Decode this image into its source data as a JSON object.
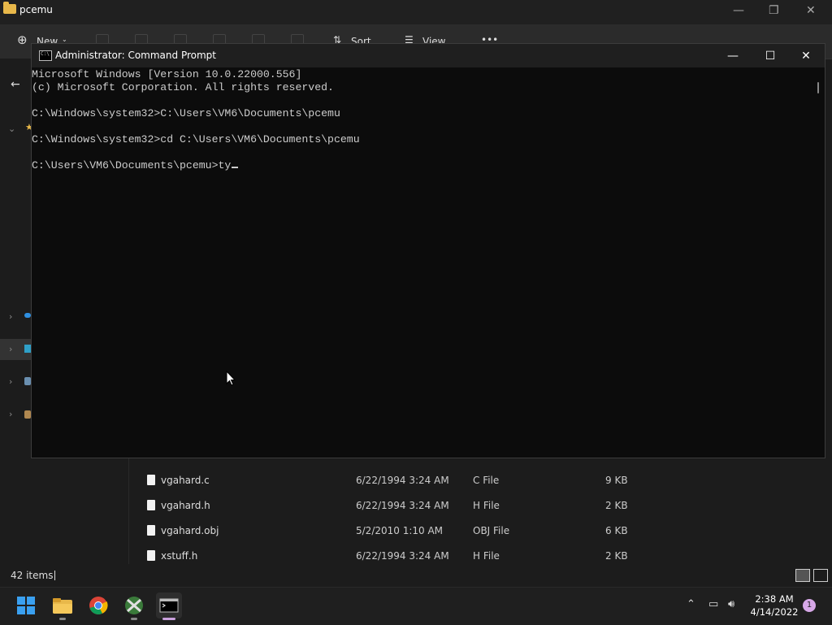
{
  "explorer": {
    "title": "pcemu",
    "toolbar": {
      "new_label": "New",
      "sort_label": "Sort",
      "view_label": "View",
      "more_label": "•••"
    },
    "files": [
      {
        "name": "vgahard.c",
        "date": "6/22/1994 3:24 AM",
        "type": "C File",
        "size": "9 KB"
      },
      {
        "name": "vgahard.h",
        "date": "6/22/1994 3:24 AM",
        "type": "H File",
        "size": "2 KB"
      },
      {
        "name": "vgahard.obj",
        "date": "5/2/2010 1:10 AM",
        "type": "OBJ File",
        "size": "6 KB"
      },
      {
        "name": "xstuff.h",
        "date": "6/22/1994 3:24 AM",
        "type": "H File",
        "size": "2 KB"
      }
    ],
    "status": {
      "items_count": "42 items"
    }
  },
  "cmd": {
    "title": "Administrator: Command Prompt",
    "icon_text": "C:\\",
    "lines": [
      "Microsoft Windows [Version 10.0.22000.556]",
      "(c) Microsoft Corporation. All rights reserved.",
      "",
      "C:\\Windows\\system32>C:\\Users\\VM6\\Documents\\pcemu",
      "",
      "C:\\Windows\\system32>cd C:\\Users\\VM6\\Documents\\pcemu",
      "",
      "C:\\Users\\VM6\\Documents\\pcemu>ty"
    ]
  },
  "taskbar": {
    "apps": [
      "start-icon",
      "file-explorer-icon",
      "chrome-icon",
      "xming-icon",
      "command-prompt-icon"
    ],
    "clock": {
      "time": "2:38 AM",
      "date": "4/14/2022"
    },
    "notification_count": "1"
  },
  "colors": {
    "explorer_bg": "#1c1c1c",
    "cmd_bg": "#0c0c0c",
    "cmd_text": "#cccccc",
    "taskbar_bg": "#1f1f1f",
    "accent": "#0078d4"
  }
}
